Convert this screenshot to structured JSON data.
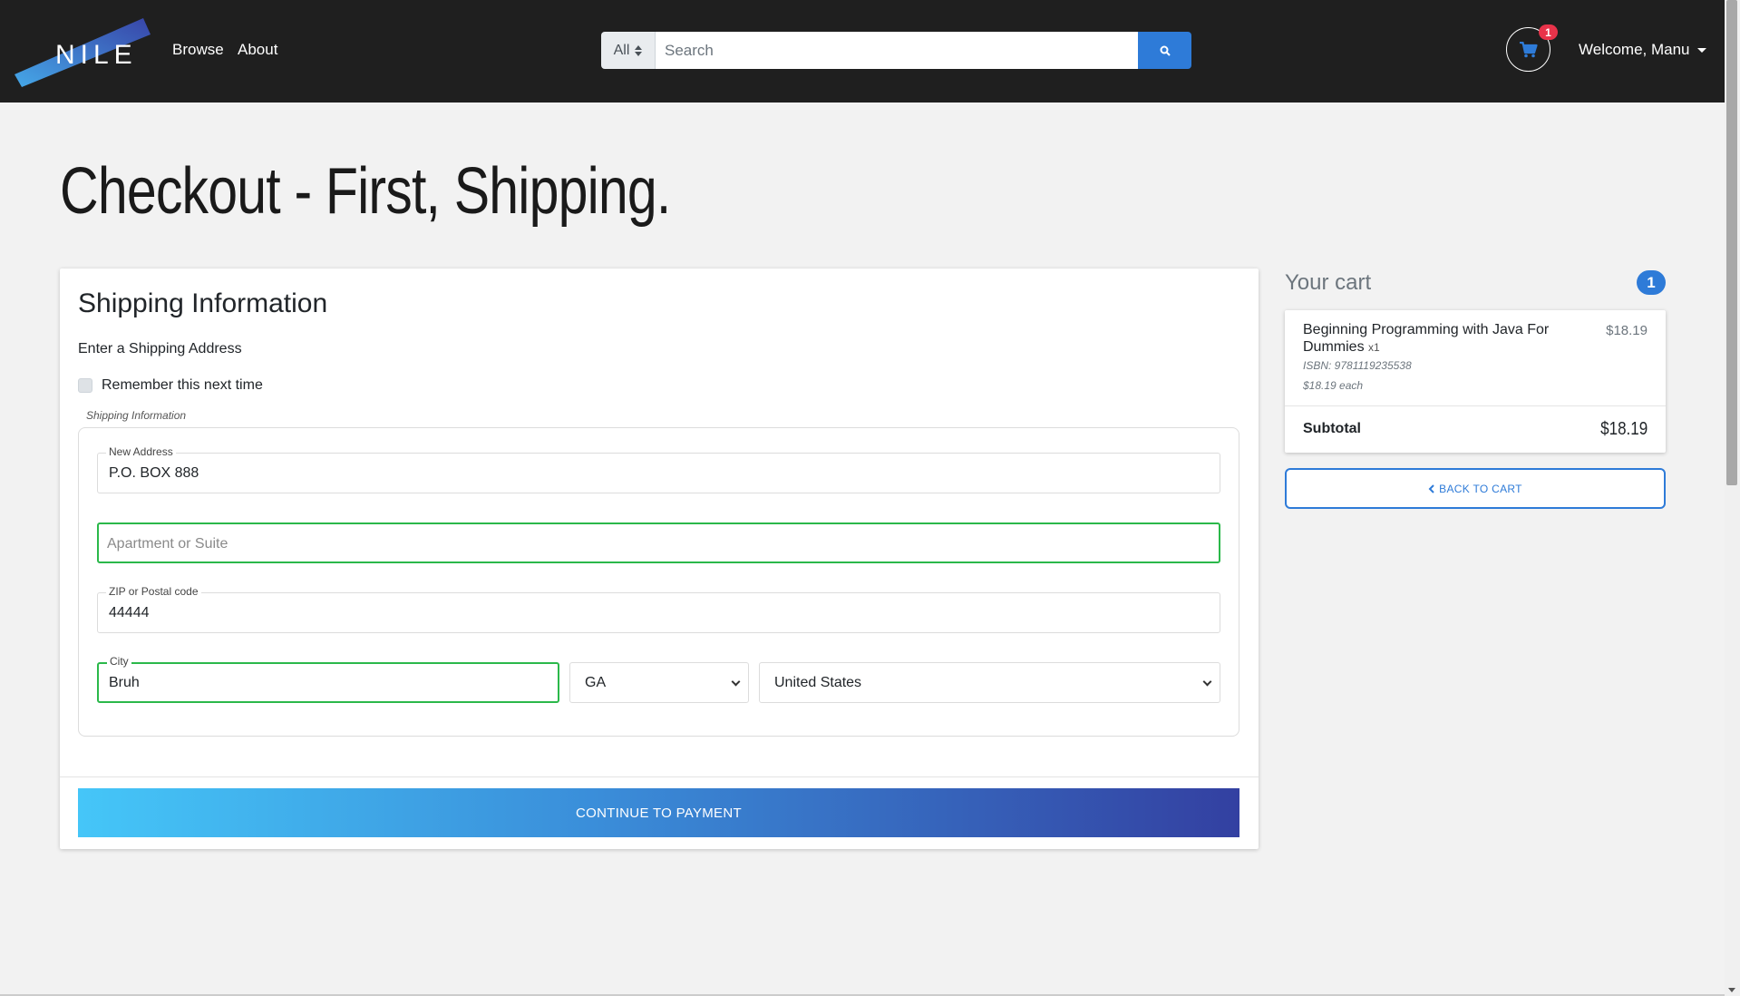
{
  "nav": {
    "logo_text": "NILE",
    "links": [
      "Browse",
      "About"
    ],
    "search": {
      "category": "All",
      "placeholder": "Search"
    },
    "cart_count": "1",
    "welcome": "Welcome, Manu"
  },
  "page": {
    "title": "Checkout - First, Shipping."
  },
  "shipping": {
    "title": "Shipping Information",
    "subtitle": "Enter a Shipping Address",
    "remember_label": "Remember this next time",
    "fieldset_legend": "Shipping Information",
    "address": {
      "label": "New Address",
      "value": "P.O. BOX 888"
    },
    "apartment": {
      "placeholder": "Apartment or Suite"
    },
    "zip": {
      "label": "ZIP or Postal code",
      "value": "44444"
    },
    "city": {
      "label": "City",
      "value": "Bruh"
    },
    "state": {
      "value": "GA"
    },
    "country": {
      "value": "United States"
    },
    "continue_label": "CONTINUE TO PAYMENT"
  },
  "cart": {
    "title": "Your cart",
    "count": "1",
    "items": [
      {
        "name": "Beginning Programming with Java For Dummies",
        "qty": "x1",
        "price": "$18.19",
        "isbn": "ISBN: 9781119235538",
        "each": "$18.19 each"
      }
    ],
    "subtotal_label": "Subtotal",
    "subtotal_value": "$18.19",
    "back_label": "BACK TO CART"
  },
  "colors": {
    "accent": "#2e7bd8",
    "valid": "#2bb84a",
    "badge": "#e8334a",
    "navbar": "#1f1f1f"
  }
}
